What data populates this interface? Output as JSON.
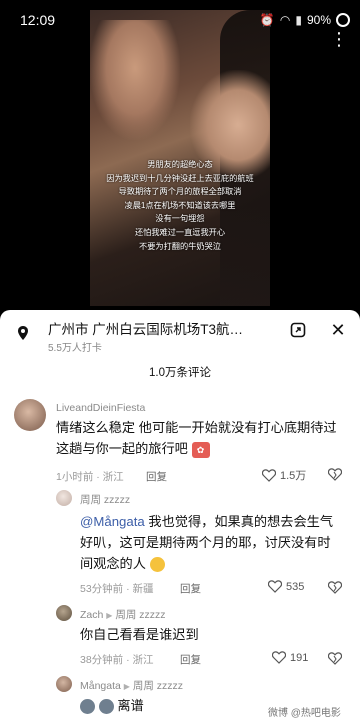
{
  "status": {
    "time": "12:09",
    "battery": "90%"
  },
  "video": {
    "caption_lines": [
      "男朋友的超绝心态",
      "因为我迟到十几分钟没赶上去亚庇的航班",
      "导致期待了两个月的旅程全部取消",
      "凌晨1点在机场不知道该去哪里",
      "没有一句埋怨",
      "还怕我难过一直逗我开心",
      "不要为打翻的牛奶哭泣"
    ]
  },
  "location": {
    "title": "广州市  广州白云国际机场T3航…",
    "checkins": "5.5万人打卡"
  },
  "comments_header": "1.0万条评论",
  "comments": [
    {
      "user": "LiveandDieinFiesta",
      "text_line1": "情绪这么稳定 他可能一开始就没有打心底期待过",
      "text_line2": "这趟与你一起的旅行吧",
      "meta": "1小时前 · 浙江",
      "reply": "回复",
      "likes": "1.5万"
    },
    {
      "user": "周周 zzzzz",
      "mention": "@Mångata",
      "text_line1": " 我也觉得，如果真的想去会生气",
      "text_line2": "好叭，这可是期待两个月的耶，讨厌没有时",
      "text_line3": "间观念的人",
      "meta": "53分钟前 · 新疆",
      "reply": "回复",
      "likes": "535"
    },
    {
      "user": "Zach",
      "reply_to": "周周 zzzzz",
      "text_line1": "你自己看看是谁迟到",
      "meta": "38分钟前 · 浙江",
      "reply": "回复",
      "likes": "191"
    },
    {
      "user": "Mångata",
      "reply_to": "周周 zzzzz",
      "text_line1": "离谱"
    }
  ],
  "watermark": "微博 @热吧电影"
}
